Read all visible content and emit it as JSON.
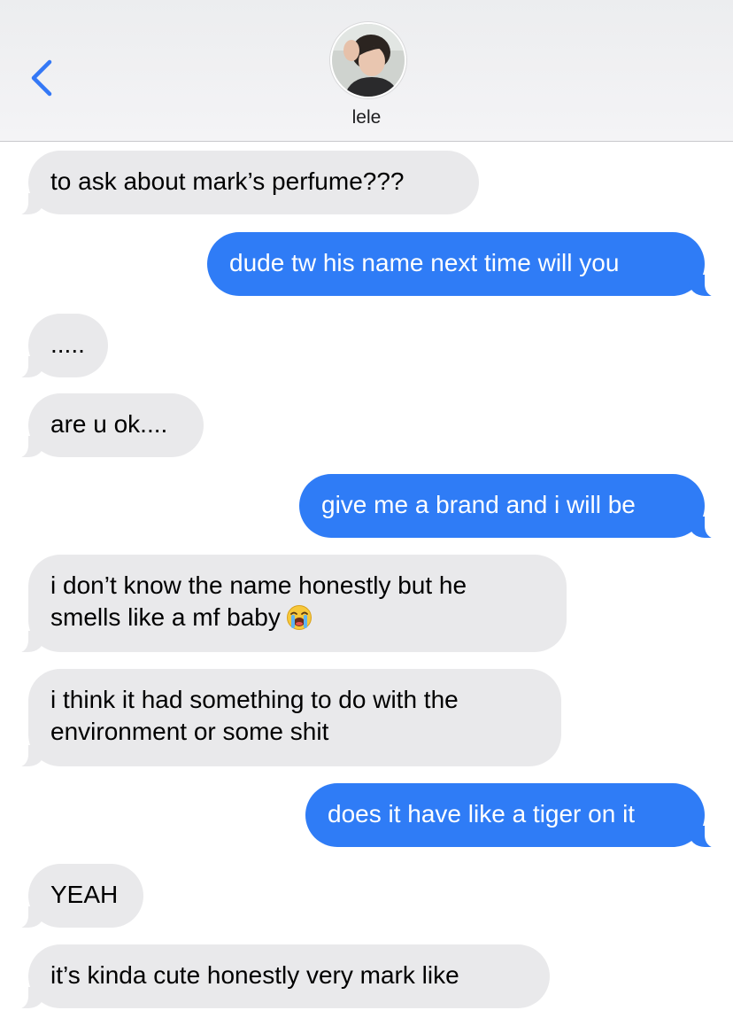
{
  "header": {
    "contact_name": "lele",
    "back_icon": "chevron-left-icon",
    "accent_color": "#3478f6"
  },
  "colors": {
    "incoming_bubble": "#e9e9eb",
    "outgoing_bubble": "#2f7cf6"
  },
  "messages": [
    {
      "direction": "in",
      "lines": [
        "to ask about mark’s perfume???"
      ]
    },
    {
      "direction": "out",
      "lines": [
        "dude tw his name next time will you"
      ]
    },
    {
      "direction": "in",
      "lines": [
        "....."
      ]
    },
    {
      "direction": "in",
      "lines": [
        "are u ok...."
      ]
    },
    {
      "direction": "out",
      "lines": [
        "give me a brand and i will be"
      ]
    },
    {
      "direction": "in",
      "lines": [
        "i don’t know the name honestly but he",
        "smells like a mf baby"
      ],
      "emoji": "loudly-crying-face-icon"
    },
    {
      "direction": "in",
      "lines": [
        "i think it had something to do with the",
        "environment or some shit"
      ]
    },
    {
      "direction": "out",
      "lines": [
        "does it have like a tiger on it"
      ]
    },
    {
      "direction": "in",
      "lines": [
        "YEAH"
      ]
    },
    {
      "direction": "in",
      "lines": [
        "it’s kinda cute honestly very mark like"
      ]
    }
  ]
}
